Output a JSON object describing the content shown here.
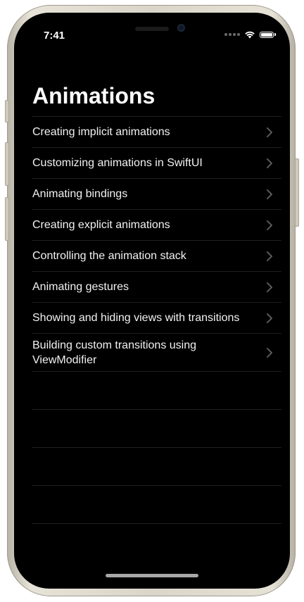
{
  "status_bar": {
    "time": "7:41",
    "icons": [
      "cellular-signal-icon",
      "wifi-icon",
      "battery-icon"
    ]
  },
  "navigation": {
    "title": "Animations"
  },
  "list": {
    "items": [
      {
        "label": "Creating implicit animations"
      },
      {
        "label": "Customizing animations in SwiftUI"
      },
      {
        "label": "Animating bindings"
      },
      {
        "label": "Creating explicit animations"
      },
      {
        "label": "Controlling the animation stack"
      },
      {
        "label": "Animating gestures"
      },
      {
        "label": "Showing and hiding views with transitions"
      },
      {
        "label": "Building custom transitions using ViewModifier"
      }
    ]
  },
  "colors": {
    "background": "#000000",
    "text": "#ffffff",
    "separator": "#1f1f1f",
    "chevron": "#5a5a5a"
  }
}
